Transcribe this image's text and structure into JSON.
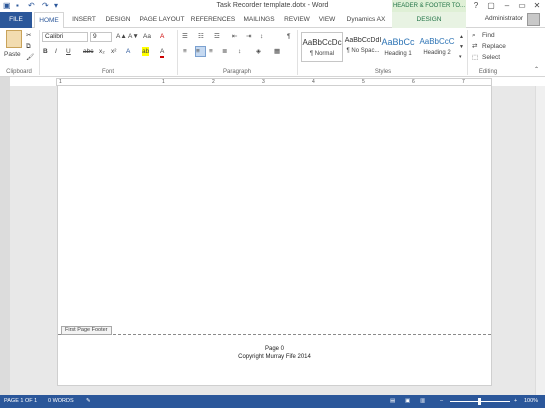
{
  "window": {
    "title": "Task Recorder template.dotx - Word",
    "contextual_label": "HEADER & FOOTER TO...",
    "qat_icons": [
      "save-icon",
      "undo-icon",
      "redo-icon"
    ],
    "buttons": [
      "?",
      "▢",
      "–",
      "▭",
      "✕"
    ]
  },
  "tabs": [
    {
      "label": "FILE"
    },
    {
      "label": "HOME"
    },
    {
      "label": "INSERT"
    },
    {
      "label": "DESIGN"
    },
    {
      "label": "PAGE LAYOUT"
    },
    {
      "label": "REFERENCES"
    },
    {
      "label": "MAILINGS"
    },
    {
      "label": "REVIEW"
    },
    {
      "label": "VIEW"
    },
    {
      "label": "Dynamics AX"
    },
    {
      "label": "DESIGN"
    }
  ],
  "account": {
    "name": "Administrator"
  },
  "ribbon": {
    "clipboard": {
      "paste": "Paste",
      "group": "Clipboard"
    },
    "font": {
      "family": "Calibri",
      "size": "9",
      "group": "Font",
      "bold": "B",
      "italic": "I",
      "underline": "U",
      "strike": "abc",
      "sub": "x₂",
      "sup": "x²",
      "grow": "A▲",
      "shrink": "A▼",
      "case": "Aa",
      "clear": "A",
      "effects": "A",
      "highlight": "ab",
      "color": "A"
    },
    "paragraph": {
      "group": "Paragraph",
      "pilcrow": "¶"
    },
    "styles": {
      "group": "Styles",
      "items": [
        {
          "sample": "AaBbCcDc",
          "name": "¶ Normal"
        },
        {
          "sample": "AaBbCcDdI",
          "name": "¶ No Spac..."
        },
        {
          "sample": "AaBbCc",
          "name": "Heading 1"
        },
        {
          "sample": "AaBbCcC",
          "name": "Heading 2"
        }
      ]
    },
    "editing": {
      "group": "Editing",
      "find": "Find",
      "replace": "Replace",
      "select": "Select"
    }
  },
  "ruler": {
    "numbers": [
      "1",
      "1",
      "2",
      "3",
      "4",
      "5",
      "6",
      "7"
    ]
  },
  "document": {
    "footer_tab": "First Page Footer",
    "footer_line1": "Page 0",
    "footer_line2": "Copyright Murray Fife 2014"
  },
  "status": {
    "page": "PAGE 1 OF 1",
    "words": "0 WORDS",
    "zoom": "100%"
  }
}
